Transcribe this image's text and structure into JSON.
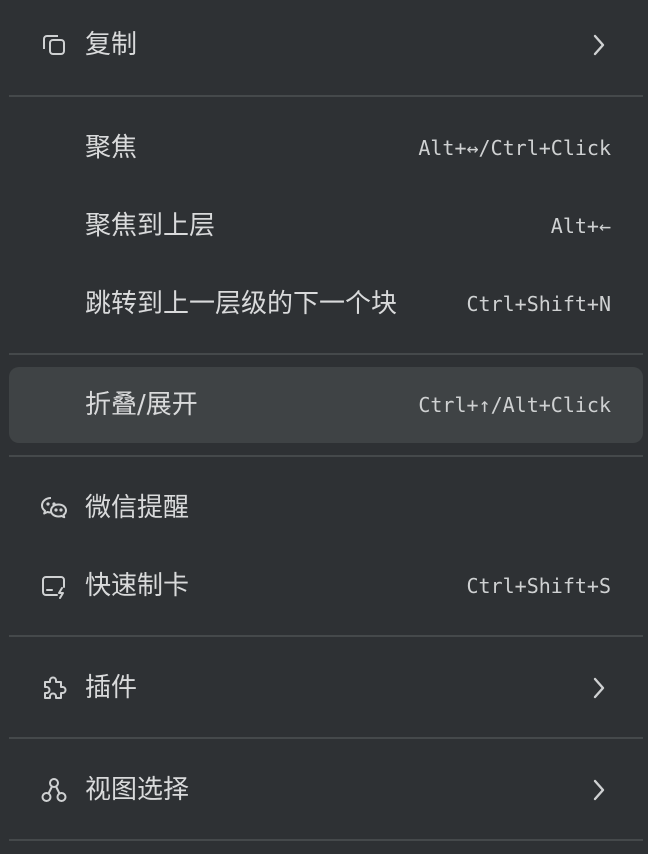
{
  "menu": {
    "items": [
      {
        "label": "复制",
        "icon": "copy-icon",
        "submenu": true
      },
      {
        "label": "聚焦",
        "shortcut": "Alt+↔/Ctrl+Click"
      },
      {
        "label": "聚焦到上层",
        "shortcut": "Alt+←"
      },
      {
        "label": "跳转到上一层级的下一个块",
        "shortcut": "Ctrl+Shift+N"
      },
      {
        "label": "折叠/展开",
        "shortcut": "Ctrl+↑/Alt+Click",
        "active": true
      },
      {
        "label": "微信提醒",
        "icon": "wechat-icon"
      },
      {
        "label": "快速制卡",
        "icon": "flashcard-icon",
        "shortcut": "Ctrl+Shift+S"
      },
      {
        "label": "插件",
        "icon": "puzzle-icon",
        "submenu": true
      },
      {
        "label": "视图选择",
        "icon": "view-graph-icon",
        "submenu": true
      }
    ]
  },
  "colors": {
    "background": "#2e3134",
    "active_background": "#3f4345",
    "divider": "#45494b",
    "text": "#d9dadb"
  }
}
